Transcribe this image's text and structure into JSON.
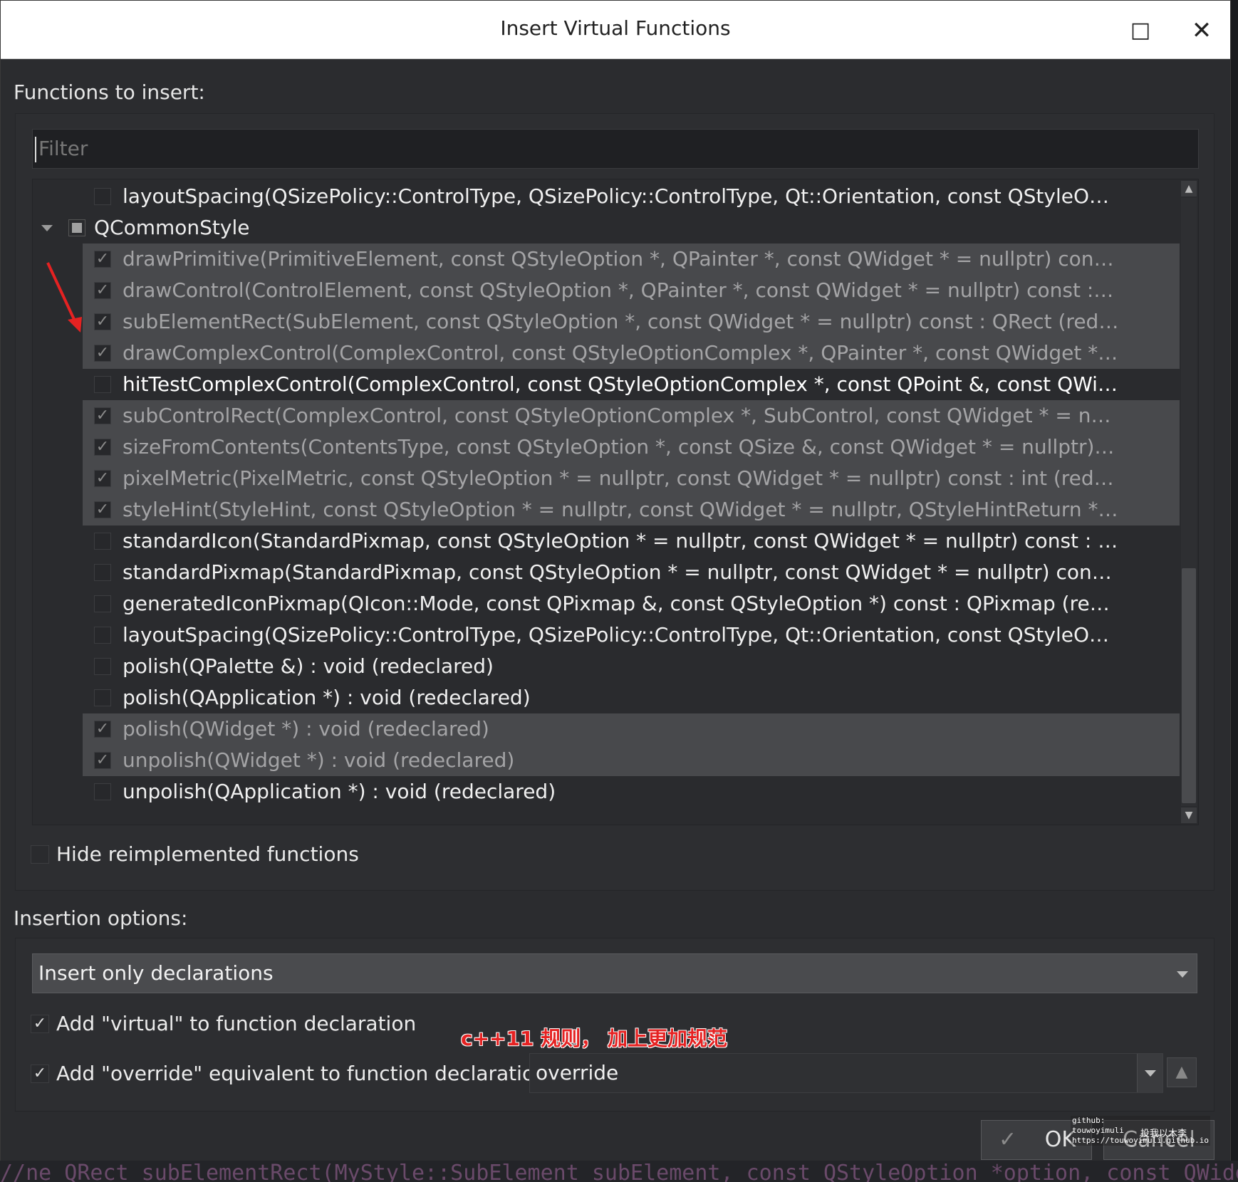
{
  "window": {
    "title": "Insert Virtual Functions",
    "maximize_icon": "□",
    "close_icon": "✕"
  },
  "functions_section": {
    "label": "Functions to insert:",
    "filter_placeholder": "Filter"
  },
  "tree": {
    "rows": [
      {
        "type": "item",
        "checked": false,
        "selected": false,
        "text": "layoutSpacing(QSizePolicy::ControlType, QSizePolicy::ControlType, Qt::Orientation, const QStyleOption * = null···"
      },
      {
        "type": "group",
        "text": "QCommonStyle"
      },
      {
        "type": "item",
        "checked": true,
        "selected": true,
        "text": "drawPrimitive(PrimitiveElement, const QStyleOption *, QPainter *, const QWidget * = nullptr) const : void (redec···"
      },
      {
        "type": "item",
        "checked": true,
        "selected": true,
        "text": "drawControl(ControlElement, const QStyleOption *, QPainter *, const QWidget * = nullptr) const : void (redeclar···"
      },
      {
        "type": "item",
        "checked": true,
        "selected": true,
        "text": "subElementRect(SubElement, const QStyleOption *, const QWidget * = nullptr) const : QRect (redeclared)"
      },
      {
        "type": "item",
        "checked": true,
        "selected": true,
        "text": "drawComplexControl(ComplexControl, const QStyleOptionComplex *, QPainter *, const QWidget * = nullptr) co···"
      },
      {
        "type": "item",
        "checked": false,
        "selected": false,
        "bright": true,
        "text": "hitTestComplexControl(ComplexControl, const QStyleOptionComplex *, const QPoint &, const QWidget * = nullp···"
      },
      {
        "type": "item",
        "checked": true,
        "selected": true,
        "text": "subControlRect(ComplexControl, const QStyleOptionComplex *, SubControl, const QWidget * = nullptr) const : ···"
      },
      {
        "type": "item",
        "checked": true,
        "selected": true,
        "text": "sizeFromContents(ContentsType, const QStyleOption *, const QSize &, const QWidget * = nullptr) const : QSize (r···"
      },
      {
        "type": "item",
        "checked": true,
        "selected": true,
        "text": "pixelMetric(PixelMetric, const QStyleOption * = nullptr, const QWidget * = nullptr) const : int (redeclared)"
      },
      {
        "type": "item",
        "checked": true,
        "selected": true,
        "text": "styleHint(StyleHint, const QStyleOption * = nullptr, const QWidget * = nullptr, QStyleHintReturn * = nullptr) const···"
      },
      {
        "type": "item",
        "checked": false,
        "selected": false,
        "text": "standardIcon(StandardPixmap, const QStyleOption * = nullptr, const QWidget * = nullptr) const : QIcon (redeclar···"
      },
      {
        "type": "item",
        "checked": false,
        "selected": false,
        "text": "standardPixmap(StandardPixmap, const QStyleOption * = nullptr, const QWidget * = nullptr) const : QPixmap (re···"
      },
      {
        "type": "item",
        "checked": false,
        "selected": false,
        "text": "generatedIconPixmap(QIcon::Mode, const QPixmap &, const QStyleOption *) const : QPixmap (redeclared)"
      },
      {
        "type": "item",
        "checked": false,
        "selected": false,
        "text": "layoutSpacing(QSizePolicy::ControlType, QSizePolicy::ControlType, Qt::Orientation, const QStyleOption * = null···"
      },
      {
        "type": "item",
        "checked": false,
        "selected": false,
        "text": "polish(QPalette &) : void (redeclared)"
      },
      {
        "type": "item",
        "checked": false,
        "selected": false,
        "text": "polish(QApplication *) : void (redeclared)"
      },
      {
        "type": "item",
        "checked": true,
        "selected": true,
        "text": "polish(QWidget *) : void (redeclared)"
      },
      {
        "type": "item",
        "checked": true,
        "selected": true,
        "text": "unpolish(QWidget *) : void (redeclared)"
      },
      {
        "type": "item",
        "checked": false,
        "selected": false,
        "text": "unpolish(QApplication *) : void (redeclared)"
      }
    ]
  },
  "hide_reimplemented": {
    "label": "Hide reimplemented functions",
    "checked": false
  },
  "insertion_section": {
    "label": "Insertion options:",
    "mode_selected": "Insert only declarations",
    "add_virtual_label": "Add \"virtual\" to function declaration",
    "add_virtual_checked": true,
    "add_override_label": "Add \"override\" equivalent to function declaration:",
    "add_override_checked": true,
    "override_value": "override",
    "annotation": "c++11 规则， 加上更加规范"
  },
  "buttons": {
    "ok": "OK",
    "cancel": "Cancel"
  },
  "watermark": {
    "text": "github:\ntouwoyimuli\nhttps://touwoyimuli.github.io",
    "cn": "投我以木李"
  },
  "background_code": "//ne    QRect subElementRect(MyStyle::SubElement subElement, const QStyleOption *option, const QWidget *widget) const"
}
